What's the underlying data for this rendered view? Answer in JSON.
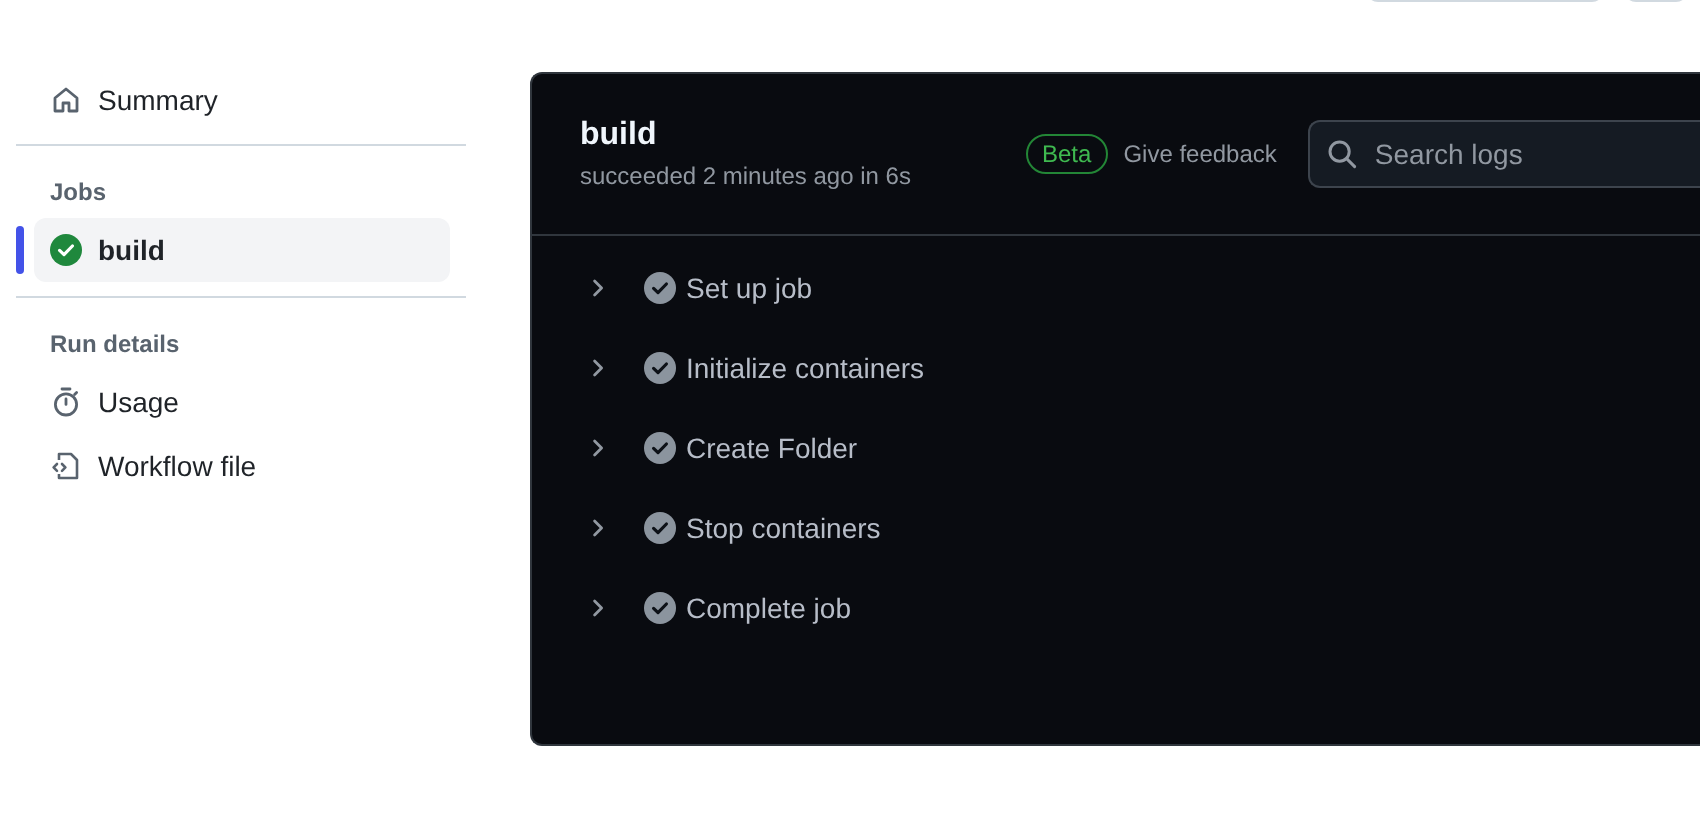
{
  "sidebar": {
    "summary": {
      "label": "Summary",
      "selected": false
    },
    "jobs": {
      "heading": "Jobs",
      "items": [
        {
          "label": "build",
          "selected": true,
          "passed": true
        }
      ]
    },
    "run_details": {
      "heading": "Run details",
      "items": [
        {
          "label": "Usage"
        },
        {
          "label": "Workflow file"
        }
      ]
    }
  },
  "job": {
    "title": "build",
    "subtitle": "succeeded 2 minutes ago in 6s",
    "badge": "Beta",
    "feedback": "Give feedback",
    "search": {
      "placeholder": "Search logs"
    },
    "steps": [
      {
        "label": "Set up job",
        "expanded": false,
        "passed": true
      },
      {
        "label": "Initialize containers",
        "expanded": false,
        "passed": true
      },
      {
        "label": "Create Folder",
        "expanded": false,
        "passed": true
      },
      {
        "label": "Stop containers",
        "expanded": false,
        "passed": true
      },
      {
        "label": "Complete job",
        "expanded": false,
        "passed": true
      }
    ]
  }
}
